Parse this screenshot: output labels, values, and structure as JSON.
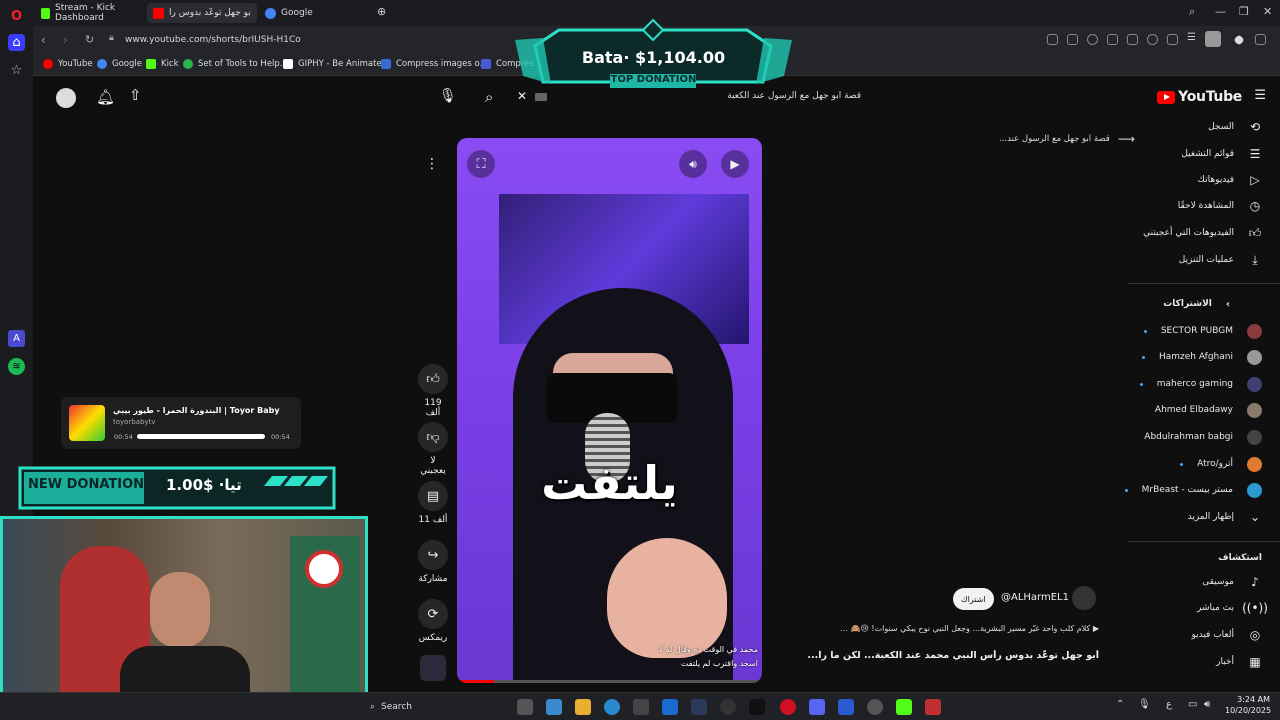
{
  "browser": {
    "tabs": [
      {
        "label": "Stream - Kick Dashboard",
        "color": "#53fc18"
      },
      {
        "label": "أبو جهل توعّد بدوس رأ...",
        "color": "#ff0000"
      },
      {
        "label": "Google",
        "color": "#4285f4"
      }
    ],
    "url": "www.youtube.com/shorts/brIUSH-H1Co",
    "bookmarks": [
      "YouTube",
      "Google",
      "Kick",
      "Set of Tools to Help...",
      "GIPHY - Be Animated",
      "Compress images o...",
      "Compres"
    ]
  },
  "youtube": {
    "logo": "YouTube",
    "search_query": "قصة ابو جهل مع الرسول عند الكعبة",
    "related_link": "قصة ابو جهل مع الرسول عند...",
    "nav": [
      {
        "label": "السجل",
        "icon": "history-icon"
      },
      {
        "label": "قوائم التشغيل",
        "icon": "playlist-icon"
      },
      {
        "label": "فيديوهاتك",
        "icon": "your-videos-icon"
      },
      {
        "label": "المشاهدة لاحقًا",
        "icon": "watch-later-icon"
      },
      {
        "label": "الفيديوهات التي أعجبتني",
        "icon": "like-icon"
      },
      {
        "label": "عمليات التنزيل",
        "icon": "download-icon"
      }
    ],
    "subscriptions_title": "الاشتراكات",
    "subscriptions": [
      {
        "label": "SECTOR PUBGM",
        "color": "#8a3a3a",
        "dot": true
      },
      {
        "label": "Hamzeh Afghani",
        "color": "#999999",
        "dot": true
      },
      {
        "label": "maherco gaming",
        "color": "#404070",
        "dot": true
      },
      {
        "label": "Ahmed Elbadawy",
        "color": "#8a7a6a",
        "dot": false
      },
      {
        "label": "Abdulrahman babgi",
        "color": "#444444",
        "dot": false
      },
      {
        "label": "أترو/Atro",
        "color": "#e07a30",
        "dot": true
      },
      {
        "label": "مستر بيست - MrBeast",
        "color": "#2a9ad0",
        "dot": true
      }
    ],
    "show_more": "إظهار المزيد",
    "explore_title": "استكشاف",
    "explore": [
      {
        "label": "موسيقى",
        "icon": "music-icon"
      },
      {
        "label": "بث مباشر",
        "icon": "live-icon"
      },
      {
        "label": "ألعاب فيديو",
        "icon": "gaming-icon"
      },
      {
        "label": "أخبار",
        "icon": "news-icon"
      }
    ],
    "actions": {
      "likes": "119 ألف",
      "dislike": "لا يعجبني",
      "comments": "11 ألف",
      "share": "مشاركة",
      "remix": "ريمكس"
    },
    "video": {
      "caption": "يلتفت",
      "subtitle_line1": "محمد في الوقت ده وقال له لا",
      "subtitle_line2": "اسجد واقترب لم يلتفت"
    },
    "channel": "@ALHarmEL1",
    "subscribe": "اشتراك",
    "description": "كلام كلب واحد غيّر مسير البشرية... وجعل النبي نوح يبكي سنوات! 😢🙈 ...",
    "title": "أبو جهل توعّد بدوس رأس النبي محمد عند الكعبة... لكن ما رآ..."
  },
  "overlays": {
    "top_donation_amount": "Bata· $1,104.00",
    "top_donation_label": "TOP DONATION",
    "new_donation_label": "NEW DONATION",
    "new_donation_amount": "تيا· $1.00",
    "music_title": "البندورة الحمرا - طيور بيبي | Toyor Baby",
    "music_channel": "toyorbabytv",
    "music_time_start": "00:54",
    "music_time_end": "00:54",
    "music_progress": 1.0
  },
  "taskbar": {
    "search": "Search",
    "time": "3:24 AM",
    "date": "10/20/2025",
    "lang": "ع"
  }
}
